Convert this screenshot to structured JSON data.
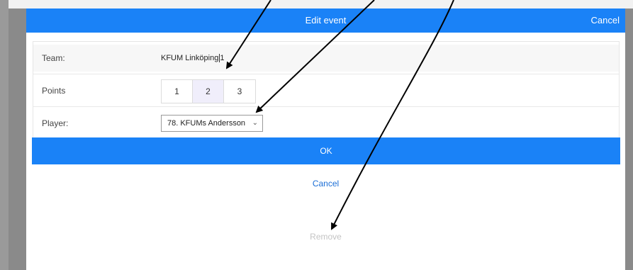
{
  "modal": {
    "title": "Edit event",
    "header_cancel": "Cancel"
  },
  "form": {
    "team": {
      "label": "Team:",
      "value": "KFUM Linköping",
      "suffix": "1"
    },
    "points": {
      "label": "Points",
      "options": [
        "1",
        "2",
        "3"
      ],
      "selected": "2"
    },
    "player": {
      "label": "Player:",
      "value": "78. KFUMs Andersson"
    }
  },
  "actions": {
    "ok_label": "OK",
    "cancel_label": "Cancel",
    "remove_label": "Remove"
  },
  "colors": {
    "primary": "#1a82f7",
    "link": "#1b6ed6",
    "disabled_text": "#c4c4c4",
    "selected_point": "#f0eefb",
    "annotation": "#000000"
  }
}
